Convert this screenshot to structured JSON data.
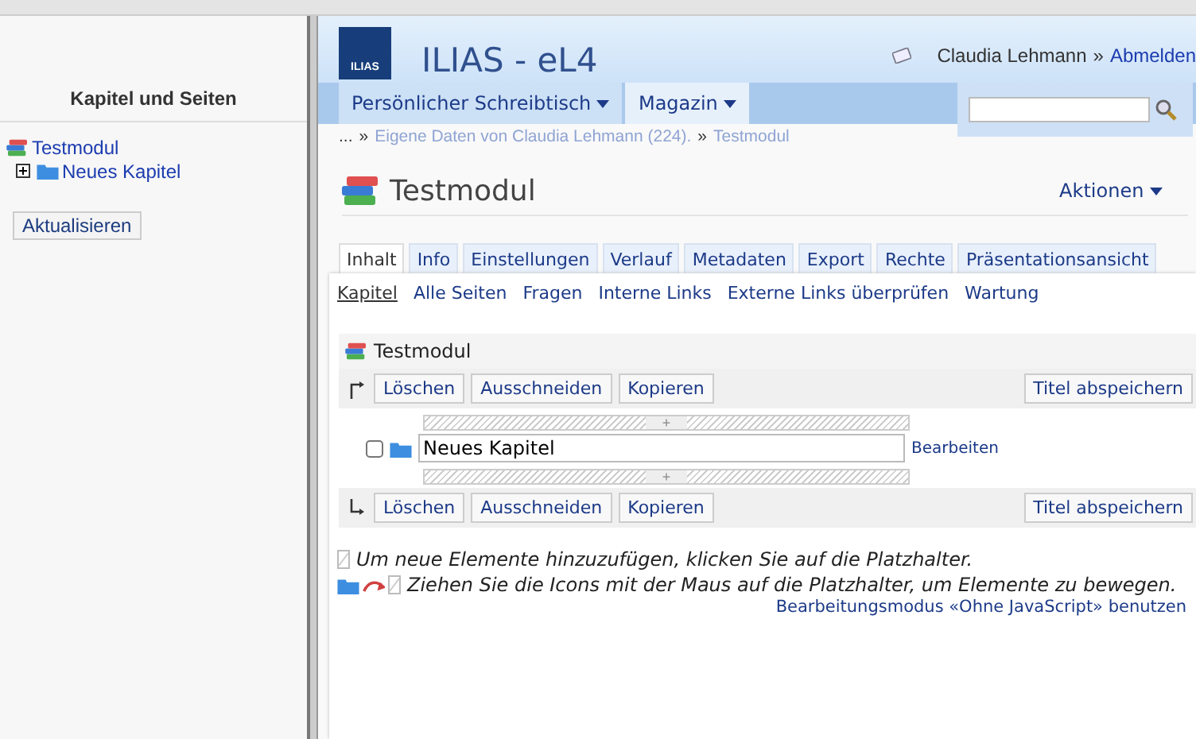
{
  "sidebar": {
    "title": "Kapitel und Seiten",
    "tree": [
      {
        "label": "Testmodul",
        "children": [
          {
            "label": "Neues Kapitel",
            "expanded": false
          }
        ]
      }
    ],
    "refresh_button": "Aktualisieren"
  },
  "header": {
    "logo": "ILIAS",
    "title": "ILIAS - eL4",
    "user": "Claudia Lehmann",
    "separator": "»",
    "logout": "Abmelden"
  },
  "nav": [
    {
      "label": "Persönlicher Schreibtisch",
      "selected": false
    },
    {
      "label": "Magazin",
      "selected": true
    }
  ],
  "breadcrumb": [
    {
      "kind": "text",
      "label": "..."
    },
    {
      "kind": "sep",
      "label": "»"
    },
    {
      "kind": "link",
      "label": "Eigene Daten von Claudia Lehmann (224)."
    },
    {
      "kind": "sep",
      "label": "»"
    },
    {
      "kind": "link",
      "label": "Testmodul"
    }
  ],
  "page_title": "Testmodul",
  "actions": "Aktionen",
  "tabs": [
    {
      "label": "Inhalt",
      "selected": true
    },
    {
      "label": "Info",
      "selected": false
    },
    {
      "label": "Einstellungen",
      "selected": false
    },
    {
      "label": "Verlauf",
      "selected": false
    },
    {
      "label": "Metadaten",
      "selected": false
    },
    {
      "label": "Export",
      "selected": false
    },
    {
      "label": "Rechte",
      "selected": false
    },
    {
      "label": "Präsentationsansicht",
      "selected": false
    }
  ],
  "subtabs": [
    {
      "label": "Kapitel",
      "selected": true
    },
    {
      "label": "Alle Seiten",
      "selected": false
    },
    {
      "label": "Fragen",
      "selected": false
    },
    {
      "label": "Interne Links",
      "selected": false
    },
    {
      "label": "Externe Links überprüfen",
      "selected": false
    },
    {
      "label": "Wartung",
      "selected": false
    }
  ],
  "editor": {
    "root_label": "Testmodul",
    "toolbars": [
      {
        "buttons": [
          "Löschen",
          "Ausschneiden",
          "Kopieren"
        ],
        "save": "Titel abspeichern"
      },
      {
        "buttons": [
          "Löschen",
          "Ausschneiden",
          "Kopieren"
        ],
        "save": "Titel abspeichern"
      }
    ],
    "chapters": [
      {
        "title": "Neues Kapitel",
        "checked": false,
        "edit_link": "Bearbeiten",
        "insert_before": "+",
        "insert_after": "+"
      }
    ],
    "hints": [
      "Um neue Elemente hinzuzufügen, klicken Sie auf die Platzhalter.",
      "Ziehen Sie die Icons mit der Maus auf die Platzhalter, um Elemente zu bewegen."
    ],
    "mode_link": "Bearbeitungsmodus «Ohne JavaScript» benutzen"
  }
}
